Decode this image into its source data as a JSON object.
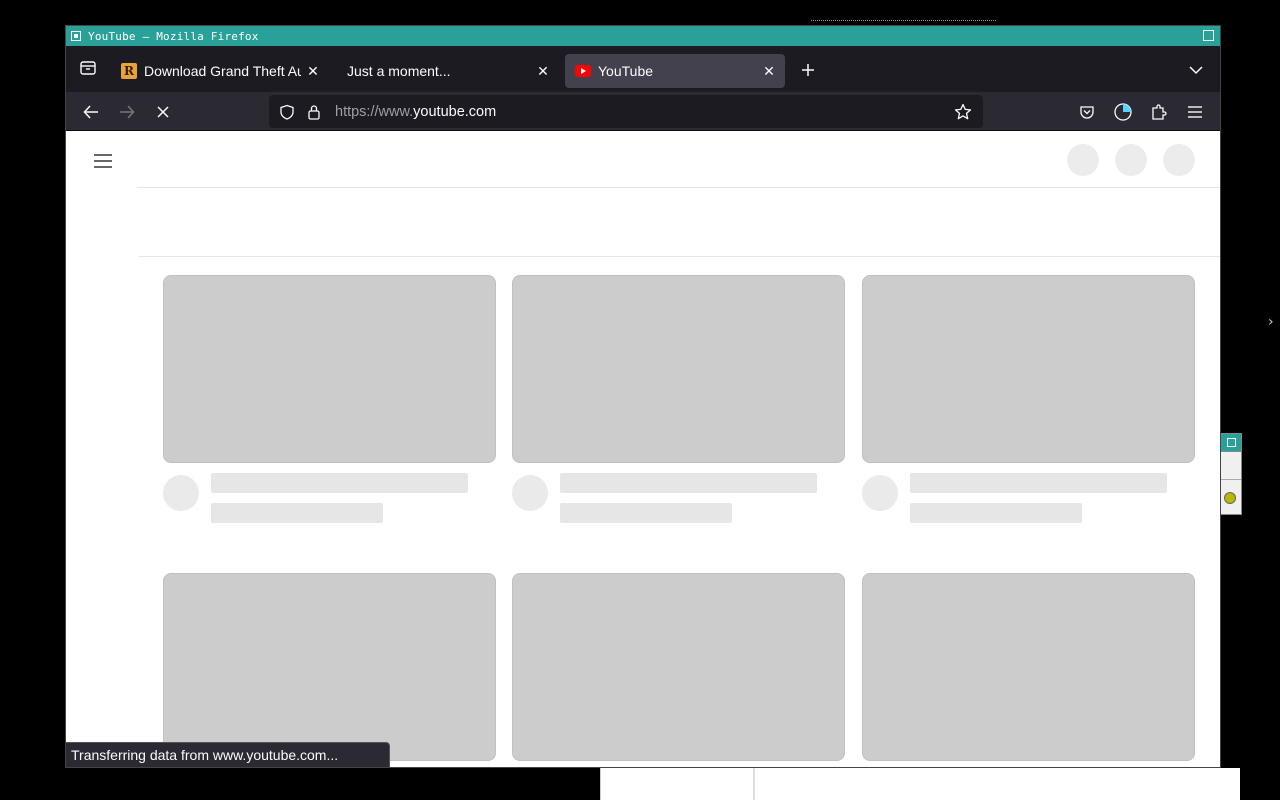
{
  "window": {
    "title": "YouTube — Mozilla Firefox"
  },
  "tabs": [
    {
      "label": "Download Grand Theft Auto",
      "favicon": "rockstar-r-icon",
      "selected": false
    },
    {
      "label": "Just a moment...",
      "favicon": "",
      "selected": false
    },
    {
      "label": "YouTube",
      "favicon": "youtube-icon",
      "selected": true
    }
  ],
  "urlbar": {
    "url_scheme_host_prefix": "https://www.",
    "url_domain": "youtube.com"
  },
  "status": {
    "text": "Transferring data from www.youtube.com..."
  },
  "colors": {
    "wm_accent": "#2aa198",
    "toolbar_bg": "#2b2a33",
    "tabbar_bg": "#1c1b22",
    "skeleton": "#cccccc"
  }
}
